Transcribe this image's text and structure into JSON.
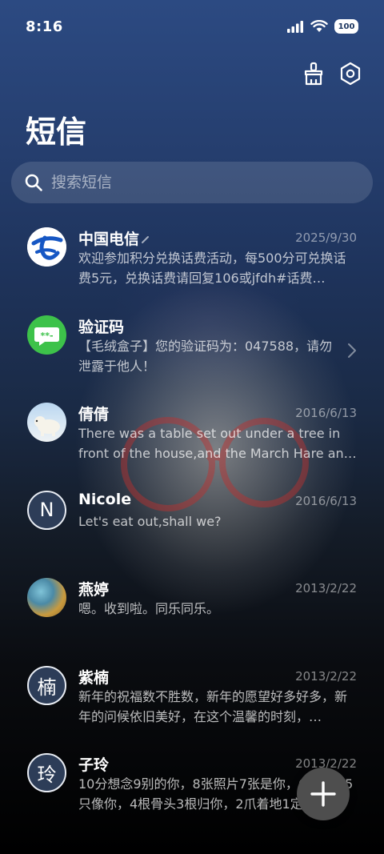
{
  "status": {
    "time": "8:16",
    "battery": "100"
  },
  "header": {
    "title": "短信"
  },
  "search": {
    "placeholder": "搜索短信"
  },
  "conversations": [
    {
      "name": "中国电信",
      "date": "2025/9/30",
      "preview": "欢迎参加积分兑换话费活动，每500分可兑换话费5元，兑换话费请回复106或jfdh#话费…",
      "avatar": "china-telecom-logo"
    },
    {
      "name": "验证码",
      "date": "",
      "preview": "【毛绒盒子】您的验证码为：047588，请勿泄露于他人！",
      "avatar": "sms-bubble"
    },
    {
      "name": "倩倩",
      "date": "2016/6/13",
      "preview": "There was a table set out under a tree in front of the house,and the March Hare an…",
      "avatar": "polar-bear-photo"
    },
    {
      "name": "Nicole",
      "date": "2016/6/13",
      "preview": "Let's eat out,shall we?",
      "avatar_letter": "N"
    },
    {
      "name": "燕婷",
      "date": "2013/2/22",
      "preview": "嗯。收到啦。同乐同乐。",
      "avatar": "landscape-photo"
    },
    {
      "name": "紫楠",
      "date": "2013/2/22",
      "preview": "新年的祝福数不胜数，新年的愿望好多好多，新年的问候依旧美好，在这个温馨的时刻，…",
      "avatar_letter": "楠"
    },
    {
      "name": "子玲",
      "date": "2013/2/22",
      "preview": "10分想念9别的你，8张照片7张是你，6只小狗5只像你，4根骨头3根归你，2爪着地1定…",
      "avatar_letter": "玲"
    }
  ],
  "colors": {
    "sms_green": "#3dc24a",
    "telecom_blue": "#1657c4",
    "fab": "#4e4e4e"
  }
}
